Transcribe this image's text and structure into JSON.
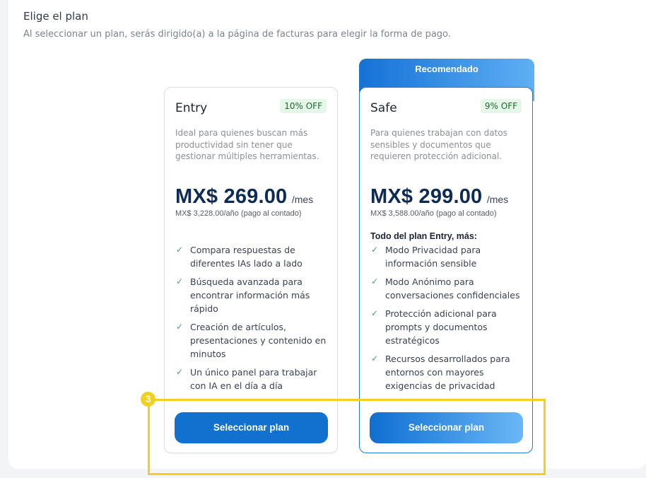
{
  "header": {
    "title": "Elige el plan",
    "subtitle": "Al seleccionar un plan, serás dirigido(a) a la página de facturas para elegir la forma de pago."
  },
  "plans": [
    {
      "name": "Entry",
      "discount": "10% OFF",
      "description": "Ideal para quienes buscan más productividad sin tener que gestionar múltiples herramientas.",
      "price": "MX$ 269.00",
      "period": "/mes",
      "annual": "MX$ 3,228.00/año (pago al contado)",
      "features_heading": "",
      "features": [
        "Compara respuestas de diferentes IAs lado a lado",
        "Búsqueda avanzada para encontrar información más rápido",
        "Creación de artículos, presentaciones y contenido en minutos",
        "Un único panel para trabajar con IA en el día a día"
      ],
      "button": "Seleccionar plan"
    },
    {
      "name": "Safe",
      "recommended_label": "Recomendado",
      "discount": "9% OFF",
      "description": "Para quienes trabajan con datos sensibles y documentos que requieren protección adicional.",
      "price": "MX$ 299.00",
      "period": "/mes",
      "annual": "MX$ 3,588.00/año (pago al contado)",
      "features_heading": "Todo del plan Entry, más:",
      "features": [
        "Modo Privacidad para información sensible",
        "Modo Anónimo para conversaciones confidenciales",
        "Protección adicional para prompts y documentos estratégicos",
        "Recursos desarrollados para entornos con mayores exigencias de privacidad"
      ],
      "button": "Seleccionar plan"
    }
  ],
  "annotation": {
    "step_number": "3",
    "color": "#f2cf20"
  },
  "colors": {
    "primary": "#1270cf",
    "price": "#0c2b55",
    "check": "#3aa669",
    "badge_bg": "#e5f7e8"
  }
}
